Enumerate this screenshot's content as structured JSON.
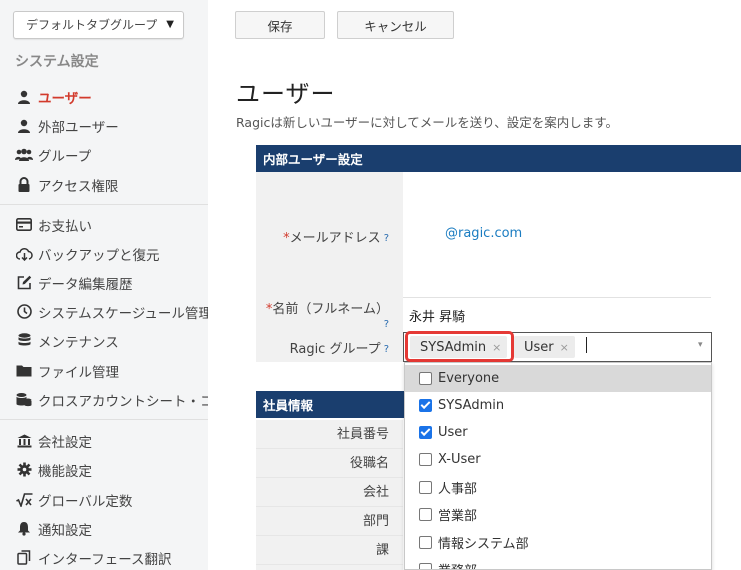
{
  "sidebar": {
    "tab_group": "デフォルトタブグループ",
    "section_title": "システム設定",
    "items": [
      {
        "label": "ユーザー",
        "icon": "user-icon"
      },
      {
        "label": "外部ユーザー",
        "icon": "user-icon"
      },
      {
        "label": "グループ",
        "icon": "users-icon"
      },
      {
        "label": "アクセス権限",
        "icon": "lock-icon"
      },
      {
        "label": "お支払い",
        "icon": "credit-card-icon"
      },
      {
        "label": "バックアップと復元",
        "icon": "cloud-download-icon"
      },
      {
        "label": "データ編集履歴",
        "icon": "edit-icon"
      },
      {
        "label": "システムスケージュール管理",
        "icon": "clock-icon"
      },
      {
        "label": "メンテナンス",
        "icon": "database-icon"
      },
      {
        "label": "ファイル管理",
        "icon": "folder-icon"
      },
      {
        "label": "クロスアカウントシート・コ",
        "icon": "database-stack-icon"
      },
      {
        "label": "会社設定",
        "icon": "bank-icon"
      },
      {
        "label": "機能設定",
        "icon": "gear-icon"
      },
      {
        "label": "グローバル定数",
        "icon": "sqrt-icon"
      },
      {
        "label": "通知設定",
        "icon": "bell-icon"
      },
      {
        "label": "インターフェース翻訳",
        "icon": "copy-icon"
      }
    ]
  },
  "toolbar": {
    "save": "保存",
    "cancel": "キャンセル"
  },
  "page": {
    "title": "ユーザー",
    "description": "Ragicは新しいユーザーに対してメールを送り、設定を案内します。"
  },
  "internal_section": {
    "header": "内部ユーザー設定",
    "email_label": "メールアドレス",
    "email_value": "@ragic.com",
    "name_label": "名前（フルネーム）",
    "name_value": "永井 昇騎",
    "group_label": "Ragic グループ",
    "required_mark": "*",
    "help_mark": "?"
  },
  "group_select": {
    "selected": [
      "SYSAdmin",
      "User"
    ],
    "remove_mark": "×",
    "arrow": "▾",
    "options": [
      {
        "label": "Everyone",
        "checked": false
      },
      {
        "label": "SYSAdmin",
        "checked": true
      },
      {
        "label": "User",
        "checked": true
      },
      {
        "label": "X-User",
        "checked": false
      },
      {
        "label": "人事部",
        "checked": false
      },
      {
        "label": "営業部",
        "checked": false
      },
      {
        "label": "情報システム部",
        "checked": false
      },
      {
        "label": "業務部",
        "checked": false
      }
    ]
  },
  "employee_section": {
    "header": "社員情報",
    "fields": [
      "社員番号",
      "役職名",
      "会社",
      "部門",
      "課"
    ]
  },
  "colors": {
    "accent": "#d23a2c",
    "header_bg": "#1a3e6e",
    "highlight": "#e53935",
    "check": "#1a73e8"
  }
}
